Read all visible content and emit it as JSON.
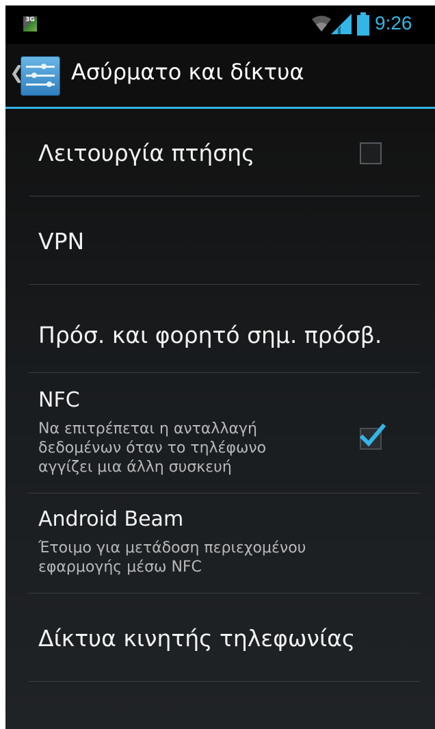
{
  "status_bar": {
    "network_badge": "3G",
    "time": "9:26",
    "icons": [
      "wifi-icon",
      "signal-icon",
      "battery-icon"
    ]
  },
  "action_bar": {
    "title": "Ασύρματο και δίκτυα",
    "icon": "settings-sliders-icon"
  },
  "settings": {
    "airplane": {
      "title": "Λειτουργία πτήσης",
      "checked": false
    },
    "vpn": {
      "title": "VPN"
    },
    "hotspot": {
      "title": "Πρόσ. και φορητό σημ. πρόσβ."
    },
    "nfc": {
      "title": "NFC",
      "summary_line1": "Να επιτρέπεται η ανταλλαγή",
      "summary_line2": "δεδομένων όταν το τηλέφωνο",
      "summary_line3": "αγγίζει μια άλλη συσκευή",
      "checked": true
    },
    "android_beam": {
      "title": "Android Beam",
      "summary_line1": "Έτοιμο για μετάδοση περιεχομένου",
      "summary_line2": "εφαρμογής μέσω NFC"
    },
    "mobile_networks": {
      "title": "Δίκτυα κινητής τηλεφωνίας"
    }
  },
  "colors": {
    "accent": "#33b5e5",
    "background": "#1a1d20",
    "text": "#f2f2f2",
    "summary": "#b8b8b8"
  }
}
